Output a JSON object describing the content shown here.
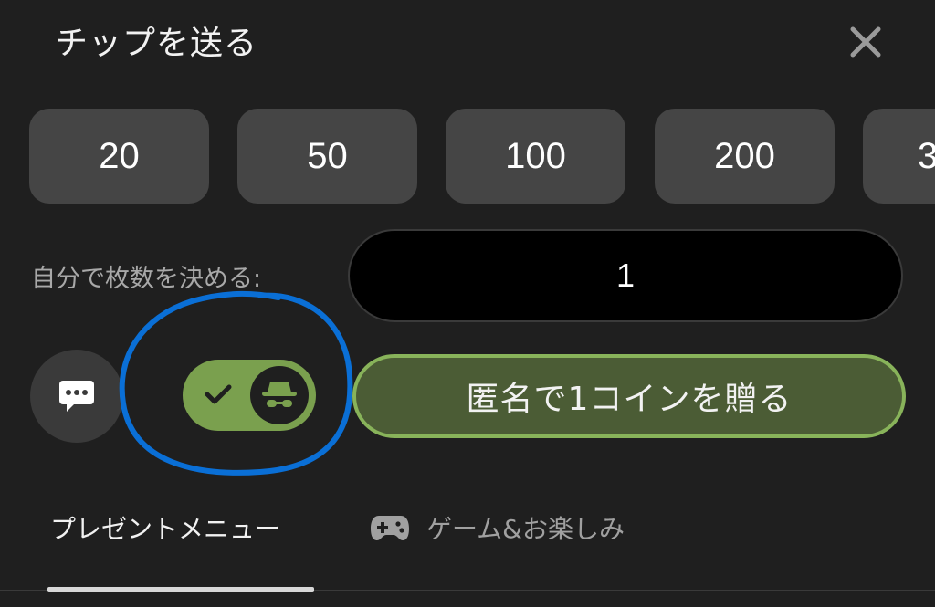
{
  "dialog": {
    "title": "チップを送る",
    "close_icon": "close-icon"
  },
  "amounts": [
    {
      "label": "20"
    },
    {
      "label": "50"
    },
    {
      "label": "100"
    },
    {
      "label": "200"
    },
    {
      "label": "3"
    }
  ],
  "custom": {
    "label": "自分で枚数を決める:",
    "value": "1"
  },
  "actions": {
    "chat_icon": "chat-bubble-icon",
    "anonymous_toggle": {
      "on": true,
      "icons": [
        "checkmark-icon",
        "incognito-icon"
      ]
    },
    "send_label": "匿名で1コインを贈る"
  },
  "tabs": [
    {
      "label": "プレゼントメニュー",
      "active": true
    },
    {
      "label": "ゲーム&お楽しみ",
      "active": false,
      "icon": "gamepad-icon"
    }
  ],
  "colors": {
    "background": "#1f1f1f",
    "amount_button": "#454545",
    "accent_green": "#7aa04e",
    "send_button_bg": "#4b5c35",
    "send_button_border": "#88b35a",
    "annotation_blue": "#0a6fd6"
  }
}
